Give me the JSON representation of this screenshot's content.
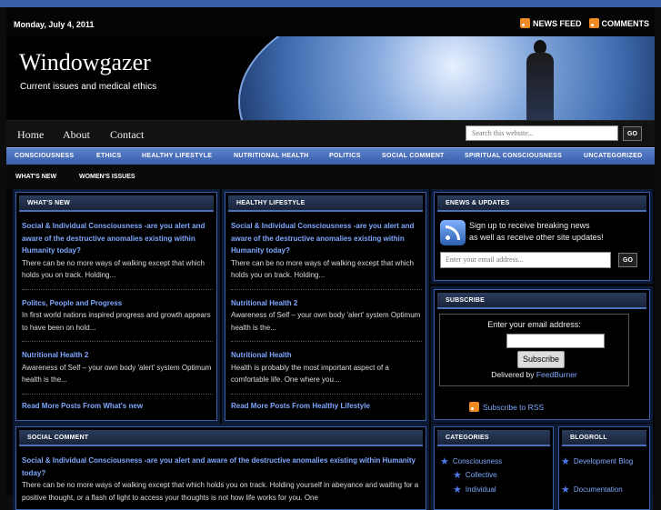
{
  "topbar": {
    "date": "Monday, July 4, 2011",
    "news_feed": "NEWS FEED",
    "comments": "COMMENTS"
  },
  "header": {
    "title": "Windowgazer",
    "description": "Current issues and medical ethics"
  },
  "nav": {
    "items": [
      "Home",
      "About",
      "Contact"
    ],
    "search_placeholder": "Search this website...",
    "go": "GO"
  },
  "categories_bar": [
    "CONSCIOUSNESS",
    "ETHICS",
    "HEALTHY LIFESTYLE",
    "NUTRITIONAL HEALTH",
    "POLITICS",
    "SOCIAL COMMENT",
    "SPIRITUAL CONSCIOUSNESS",
    "UNCATEGORIZED"
  ],
  "subbar": [
    "WHAT'S NEW",
    "WOMEN'S ISSUES"
  ],
  "whats_new": {
    "heading": "WHAT'S NEW",
    "posts": [
      {
        "title": "Social & Individual Consciousness -are you alert and aware of the destructive anomalies existing within Humanity today?",
        "excerpt": "There can be no more ways of walking except that which holds you on track. Holding..."
      },
      {
        "title": "Politcs, People and Progress",
        "excerpt": "In first world nations inspired progress and growth appears to have been on hold..."
      },
      {
        "title": "Nutritional Health 2",
        "excerpt": "Awareness of Self – your own body  'alert' system Optimum health is the..."
      }
    ],
    "read_more": "Read More Posts From What's new"
  },
  "healthy_lifestyle": {
    "heading": "HEALTHY LIFESTYLE",
    "posts": [
      {
        "title": "Social & Individual Consciousness -are you alert and aware of the destructive anomalies existing within Humanity today?",
        "excerpt": "There can be no more ways of walking except that which holds you on track. Holding..."
      },
      {
        "title": "Nutritional Health 2",
        "excerpt": "Awareness of Self – your own body  'alert' system Optimum health is the..."
      },
      {
        "title": "Nutritional Health",
        "excerpt": "Health is probably the most important aspect of a comfortable life. One where you..."
      }
    ],
    "read_more": "Read More Posts From Healthy Lifestyle"
  },
  "social_comment": {
    "heading": "SOCIAL COMMENT",
    "post_title": "Social & Individual Consciousness -are you alert and aware of the destructive anomalies existing within Humanity today?",
    "excerpt": "There can be no more ways of walking except that which holds you on track. Holding yourself in abeyance and waiting for a positive thought, or a flash of light to access your thoughts is not how life works for you. One"
  },
  "enews": {
    "heading": "ENEWS & UPDATES",
    "line1": "Sign up to receive breaking news",
    "line2": "as well as receive other site updates!",
    "email_placeholder": "Enter your email address...",
    "go": "GO"
  },
  "subscribe": {
    "heading": "SUBSCRIBE",
    "prompt": "Enter your email address:",
    "button": "Subscribe",
    "delivered_by": "Delivered by",
    "feedburner": "FeedBurner",
    "rss_link": "Subscribe to RSS"
  },
  "categories": {
    "heading": "CATEGORIES",
    "items": [
      "Consciousness",
      "Collective",
      "Individual"
    ]
  },
  "blogroll": {
    "heading": "BLOGROLL",
    "items": [
      "Development Blog",
      "Documentation"
    ]
  },
  "colors": {
    "accent": "#3a5ea8",
    "link": "#7fa8ff",
    "background": "#050505"
  }
}
